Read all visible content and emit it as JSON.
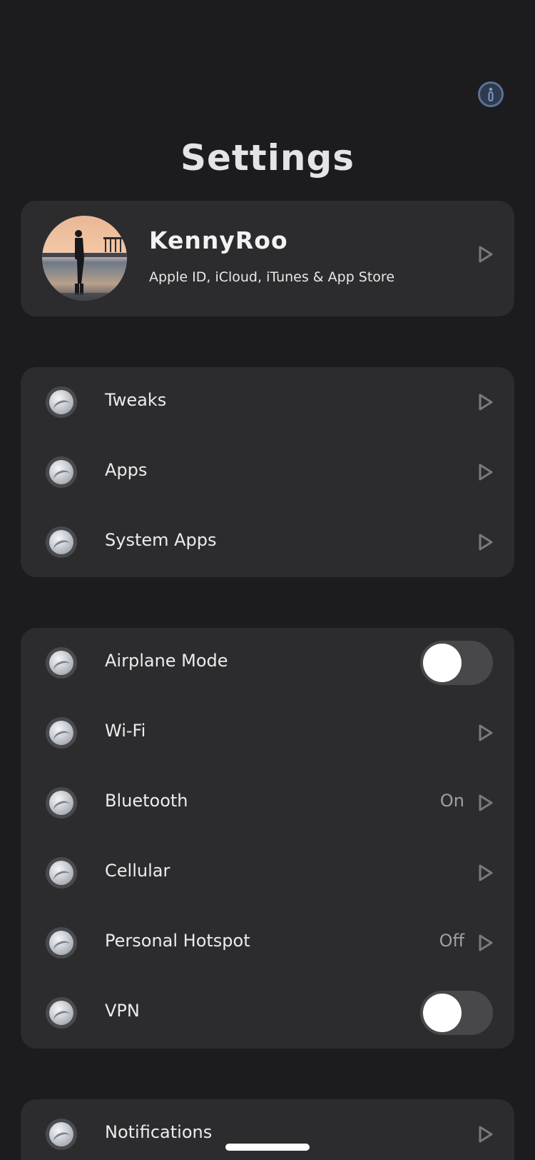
{
  "header": {
    "title": "Settings",
    "info_icon": "info-icon"
  },
  "profile": {
    "name": "KennyRoo",
    "subtitle": "Apple ID, iCloud, iTunes & App Store",
    "avatar": "avatar-photo"
  },
  "group1": {
    "items": [
      {
        "label": "Tweaks",
        "icon": "settings-orb-icon"
      },
      {
        "label": "Apps",
        "icon": "settings-orb-icon"
      },
      {
        "label": "System Apps",
        "icon": "settings-orb-icon"
      }
    ]
  },
  "group2": {
    "items": [
      {
        "label": "Airplane Mode",
        "control": "toggle",
        "on": false
      },
      {
        "label": "Wi-Fi"
      },
      {
        "label": "Bluetooth",
        "value": "On"
      },
      {
        "label": "Cellular"
      },
      {
        "label": "Personal Hotspot",
        "value": "Off"
      },
      {
        "label": "VPN",
        "control": "toggle",
        "on": false
      }
    ]
  },
  "group3": {
    "items": [
      {
        "label": "Notifications"
      }
    ]
  },
  "colors": {
    "background": "#1c1c1f",
    "card": "#2c2c2e",
    "toggle_off": "#48484b",
    "accent_info": "#5a7299"
  }
}
